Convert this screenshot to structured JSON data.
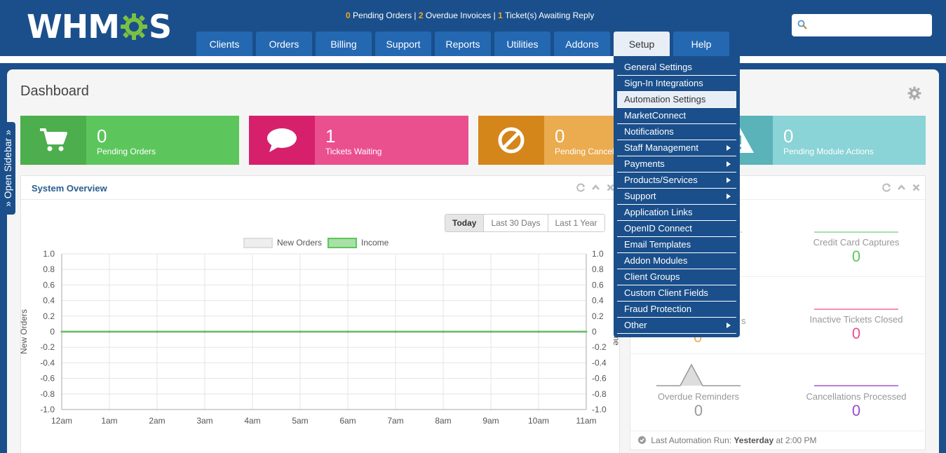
{
  "header": {
    "logo_left": "WHM",
    "logo_right": "S",
    "status": {
      "pending_orders_count": "0",
      "pending_orders_label": "Pending Orders",
      "overdue_count": "2",
      "overdue_label": "Overdue Invoices",
      "tickets_count": "1",
      "tickets_label": "Ticket(s) Awaiting Reply",
      "separator": "|"
    },
    "search_placeholder": ""
  },
  "nav": {
    "tabs": [
      "Clients",
      "Orders",
      "Billing",
      "Support",
      "Reports",
      "Utilities",
      "Addons",
      "Setup",
      "Help"
    ],
    "active": "Setup"
  },
  "sidebar": {
    "open_label": "»  Open Sidebar  »"
  },
  "page": {
    "title": "Dashboard"
  },
  "tiles": [
    {
      "count": "0",
      "label": "Pending Orders",
      "icon": "cart-icon",
      "icon_bg": "#4cae4c",
      "bg": "#5cc65c"
    },
    {
      "count": "1",
      "label": "Tickets Waiting",
      "icon": "chat-bubble-icon",
      "icon_bg": "#d6206b",
      "bg": "#ea4f8e"
    },
    {
      "count": "0",
      "label": "Pending Cancellations",
      "icon": "ban-icon",
      "icon_bg": "#d4861b",
      "bg": "#ebab4f"
    },
    {
      "count": "0",
      "label": "Pending Module Actions",
      "icon": "warning-icon",
      "icon_bg": "#5ab3b8",
      "bg": "#8ad3d6"
    }
  ],
  "system_overview": {
    "title": "System Overview",
    "range_buttons": [
      "Today",
      "Last 30 Days",
      "Last 1 Year"
    ],
    "selected_range": "Today"
  },
  "chart_data": {
    "type": "line",
    "x": [
      "12am",
      "1am",
      "2am",
      "3am",
      "4am",
      "5am",
      "6am",
      "7am",
      "8am",
      "9am",
      "10am",
      "11am"
    ],
    "series": [
      {
        "name": "New Orders",
        "values": [
          0,
          0,
          0,
          0,
          0,
          0,
          0,
          0,
          0,
          0,
          0,
          0
        ],
        "color": "#dddddd"
      },
      {
        "name": "Income",
        "values": [
          0,
          0,
          0,
          0,
          0,
          0,
          0,
          0,
          0,
          0,
          0,
          0
        ],
        "color": "#5cc65c"
      }
    ],
    "ylabel": "New Orders",
    "ylabel_right": "Income",
    "ylim": [
      -1.0,
      1.0
    ],
    "yticks": [
      "1.0",
      "0.8",
      "0.6",
      "0.4",
      "0.2",
      "0",
      "-0.2",
      "-0.4",
      "-0.6",
      "-0.8",
      "-1.0"
    ],
    "grid": true,
    "legend_placement": "top-center"
  },
  "automation": {
    "cells": [
      {
        "label": "Credit Card Captures",
        "value": "0",
        "color": "#5cc65c"
      },
      {
        "label": "Inactive Tickets Closed",
        "value": "0",
        "color": "#ea4f8e"
      },
      {
        "label": "Overdue Reminders",
        "value": "0",
        "color": "#999999"
      },
      {
        "label": "Cancellations Processed",
        "value": "0",
        "color": "#9b4dca"
      }
    ],
    "partial_hidden_value": "0",
    "partial_hidden_label": "s",
    "footer_prefix": "Last Automation Run:",
    "footer_when": "Yesterday",
    "footer_suffix": "at 2:00 PM"
  },
  "setup_menu": {
    "items": [
      {
        "label": "General Settings",
        "sub": false
      },
      {
        "label": "Sign-In Integrations",
        "sub": false
      },
      {
        "label": "Automation Settings",
        "sub": false,
        "highlight": true
      },
      {
        "label": "MarketConnect",
        "sub": false
      },
      {
        "label": "Notifications",
        "sub": false
      },
      {
        "label": "Staff Management",
        "sub": true
      },
      {
        "label": "Payments",
        "sub": true
      },
      {
        "label": "Products/Services",
        "sub": true
      },
      {
        "label": "Support",
        "sub": true
      },
      {
        "label": "Application Links",
        "sub": false
      },
      {
        "label": "OpenID Connect",
        "sub": false
      },
      {
        "label": "Email Templates",
        "sub": false
      },
      {
        "label": "Addon Modules",
        "sub": false
      },
      {
        "label": "Client Groups",
        "sub": false
      },
      {
        "label": "Custom Client Fields",
        "sub": false
      },
      {
        "label": "Fraud Protection",
        "sub": false
      },
      {
        "label": "Other",
        "sub": true
      }
    ]
  }
}
